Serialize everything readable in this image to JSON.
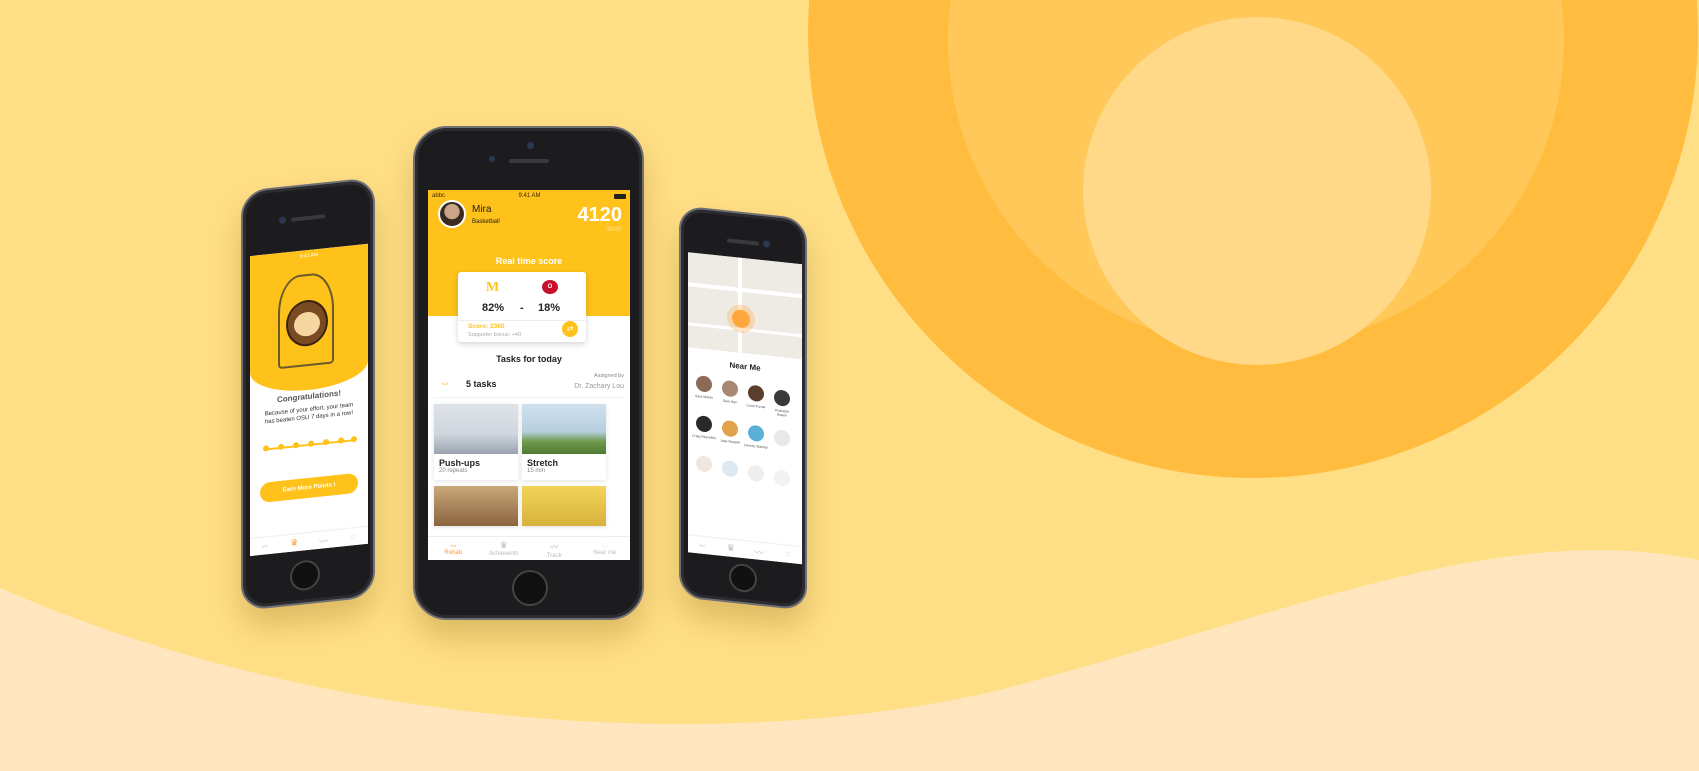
{
  "center_phone": {
    "status": {
      "carrier": "abbc",
      "time": "9:41 AM"
    },
    "user": {
      "name": "Mira",
      "sport": "Basketball",
      "score": "4120",
      "score_max": "/5000"
    },
    "realtime_label": "Real time score",
    "match": {
      "left_pct": "82%",
      "separator": "-",
      "right_pct": "18%",
      "score_text": "Score: 2360",
      "bonus_text": "Supporter bonus: +40"
    },
    "tasks": {
      "title": "Tasks for today",
      "count": "5 tasks",
      "assigned_label": "Assigned by",
      "assigned_name": "Dr. Zachary Lou",
      "items": [
        {
          "name": "Push-ups",
          "detail": "20 repeats"
        },
        {
          "name": "Stretch",
          "detail": "15 min"
        }
      ]
    },
    "tabs": [
      {
        "label": "Rehab",
        "icon": "dumbbell-icon",
        "glyph": "⇔"
      },
      {
        "label": "Achievents",
        "icon": "trophy-icon",
        "glyph": "♛"
      },
      {
        "label": "Track",
        "icon": "chart-icon",
        "glyph": "〰"
      },
      {
        "label": "Near me",
        "icon": "chat-icon",
        "glyph": "◌"
      }
    ]
  },
  "left_phone": {
    "time": "9:41 AM",
    "title": "Congratulations!",
    "message": "Because of your effort, your team has beaten OSU 7 days in a row!",
    "button": "Earn More Points !",
    "progress_dots": 7
  },
  "right_phone": {
    "section_title": "Near Me",
    "people": [
      "Sara Martin",
      "Sam Hen",
      "Carol Turner",
      "Probable Rosen",
      "Craig Reynolds",
      "Jose Russell",
      "Dennis Stanley",
      "",
      "",
      "",
      "",
      ""
    ]
  },
  "colors": {
    "accent": "#FFC21A",
    "orange": "#FF9A3C",
    "bg": "#FFDF85"
  }
}
